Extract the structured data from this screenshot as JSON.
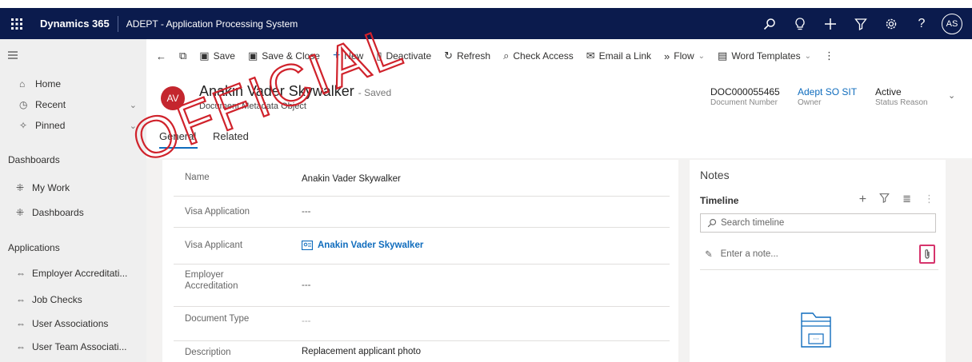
{
  "topbar": {
    "app_name": "Dynamics 365",
    "app_title": "ADEPT - Application Processing System",
    "user_initials": "AS"
  },
  "sidebar": {
    "items": [
      {
        "label": "Home",
        "icon": "home-icon"
      },
      {
        "label": "Recent",
        "icon": "clock-icon"
      },
      {
        "label": "Pinned",
        "icon": "pin-icon"
      }
    ],
    "dashboards_header": "Dashboards",
    "dashboards": [
      {
        "label": "My Work",
        "icon": "dashboard-icon"
      },
      {
        "label": "Dashboards",
        "icon": "dashboard-icon"
      }
    ],
    "applications_header": "Applications",
    "applications": [
      {
        "label": "Employer Accreditati...",
        "icon": "entity-icon"
      },
      {
        "label": "Job Checks",
        "icon": "entity-icon"
      },
      {
        "label": "User Associations",
        "icon": "entity-icon"
      },
      {
        "label": "User Team Associati...",
        "icon": "entity-icon"
      }
    ]
  },
  "commands": {
    "save": "Save",
    "save_close": "Save & Close",
    "new": "New",
    "deactivate": "Deactivate",
    "refresh": "Refresh",
    "check_access": "Check Access",
    "email_link": "Email a Link",
    "flow": "Flow",
    "word_templates": "Word Templates"
  },
  "record": {
    "avatar_initials": "AV",
    "title": "Anakin Vader Skywalker",
    "saved_status": "- Saved",
    "entity": "Document Metadata Object",
    "doc_number": "DOC000055465",
    "doc_number_label": "Document Number",
    "owner": "Adept SO SIT",
    "owner_label": "Owner",
    "status": "Active",
    "status_label": "Status Reason"
  },
  "tabs": [
    {
      "label": "General",
      "active": true
    },
    {
      "label": "Related",
      "active": false
    }
  ],
  "form": {
    "name_label": "Name",
    "name_value": "Anakin Vader Skywalker",
    "visa_application_label": "Visa Application",
    "visa_application_value": "---",
    "visa_applicant_label": "Visa Applicant",
    "visa_applicant_value": "Anakin Vader Skywalker",
    "employer_label_1": "Employer",
    "employer_label_2": "Accreditation",
    "employer_value": "---",
    "document_type_label": "Document Type",
    "document_type_value": "---",
    "description_label": "Description",
    "description_value": "Replacement applicant photo"
  },
  "notes": {
    "title": "Notes",
    "timeline_label": "Timeline",
    "search_placeholder": "Search timeline",
    "enter_note": "Enter a note..."
  },
  "watermark": {
    "text": "OFFICIAL",
    "color": "#d0222b"
  },
  "colors": {
    "topbar": "#0b1b4d",
    "accent": "#0f6cbd",
    "avatar": "#c4262e",
    "attach_highlight": "#d6336c"
  }
}
